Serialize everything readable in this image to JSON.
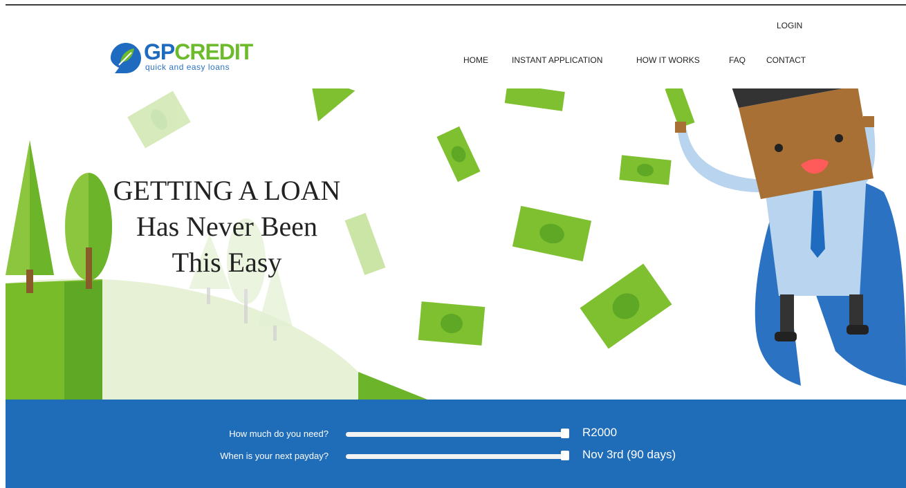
{
  "brand": {
    "name_part1": "GP",
    "name_part2": "CREDIT",
    "tagline": "quick and easy loans",
    "color_blue": "#1f6bbf",
    "color_green": "#6dbb2d"
  },
  "header": {
    "login_label": "LOGIN",
    "nav": [
      {
        "label": "HOME"
      },
      {
        "label": "INSTANT APPLICATION"
      },
      {
        "label": "HOW IT WORKS"
      },
      {
        "label": "FAQ"
      },
      {
        "label": "CONTACT"
      }
    ]
  },
  "hero": {
    "headline_line1": "GETTING A LOAN",
    "headline_line2": "Has Never Been",
    "headline_line3": "This Easy"
  },
  "calculator": {
    "amount_label": "How much do you need?",
    "amount_value": "R2000",
    "amount_slider_fraction": 1.0,
    "payday_label": "When is your next payday?",
    "payday_value": "Nov 3rd (90 days)",
    "payday_slider_fraction": 1.0,
    "bar_color": "#1f6cb8"
  }
}
